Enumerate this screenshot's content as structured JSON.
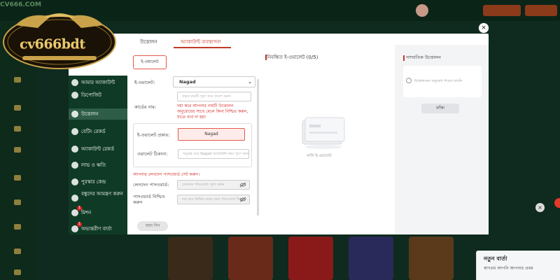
{
  "background": {
    "site_name": "CV666.COM",
    "right_panel_title": "নতুন বার্তা",
    "right_panel_text": "স্বাগতম আপনি আপনার প্রথম"
  },
  "brand": {
    "logo_text": "cv666bdt"
  },
  "modal": {
    "close_symbol": "×",
    "tabs": [
      {
        "label": "উত্তোলন"
      },
      {
        "label": "অ্যাকাউন্ট ব্যবস্থাপনা"
      }
    ],
    "sidebar": {
      "items": [
        {
          "label": "আমার অ্যাকাউন্ট",
          "badge": ""
        },
        {
          "label": "ডিপোজিট",
          "badge": ""
        },
        {
          "label": "উত্তোলন",
          "badge": ""
        },
        {
          "label": "বেটিং রেকর্ড",
          "badge": ""
        },
        {
          "label": "অ্যাকাউন্ট রেকর্ড",
          "badge": ""
        },
        {
          "label": "লাভ ও ক্ষতি",
          "badge": ""
        },
        {
          "label": "পুরস্কার কেন্দ্র",
          "badge": ""
        },
        {
          "label": "বন্ধুদের আমন্ত্রণ করুন",
          "badge": ""
        },
        {
          "label": "মিশন",
          "badge": "1"
        },
        {
          "label": "অভ্যন্তরীণ বার্তা",
          "badge": "1"
        }
      ]
    },
    "form": {
      "wallet_type_button": "ই-ওয়ালেট",
      "ewallet_label": "ই-ওয়ালেট:",
      "ewallet_selected": "Nagad",
      "name_placeholder": "প্রকৃত নামটি পূরণ করে প্রবেশ করুন",
      "card_name_label": "কার্ডের নাম:",
      "warning_name": "দয়া করে আপনার নামটি উত্তোলন অনুরোধের সাথে মেলে কিনা নিশ্চিত করুন, যাতে ব্যর্থ না হয়!",
      "ewallet_type_label": "ই-ওয়ালেট প্রকার:",
      "ewallet_type_value": "Nagad",
      "wallet_address_label": "ওয়ালেট ঠিকানা:",
      "wallet_address_placeholder": "অনুগ্রহ করে Nagad অ্যাকাউন্ট নম্বর পূরণ করুন",
      "warning_password": "আপনার লেনদেন পাসওয়ার্ড সেট করুন।",
      "tx_password_label": "লেনদেন পাসওয়ার্ড:",
      "tx_password_placeholder": "লেনদেন পাসওয়ার্ড পূরণ করুন",
      "confirm_password_label": "পাসওয়ার্ড নিশ্চিত করুন",
      "confirm_password_placeholder": "দয়া করে নিশ্চিত করার জন্য পাসওয়ার্ড লিখুন",
      "submit_label": "জমা দিন"
    },
    "wallets": {
      "title": "নিবন্ধিত ই-ওয়ালেট (0/5)",
      "empty_text": "খালি ই-ওয়ালেট"
    },
    "recent": {
      "title": "সাম্প্রতিক উত্তোলন",
      "empty_text": "উত্তোলনের অনুরোধ পাওয়া যায়নি",
      "clear_label": "ফাঁকা"
    }
  }
}
